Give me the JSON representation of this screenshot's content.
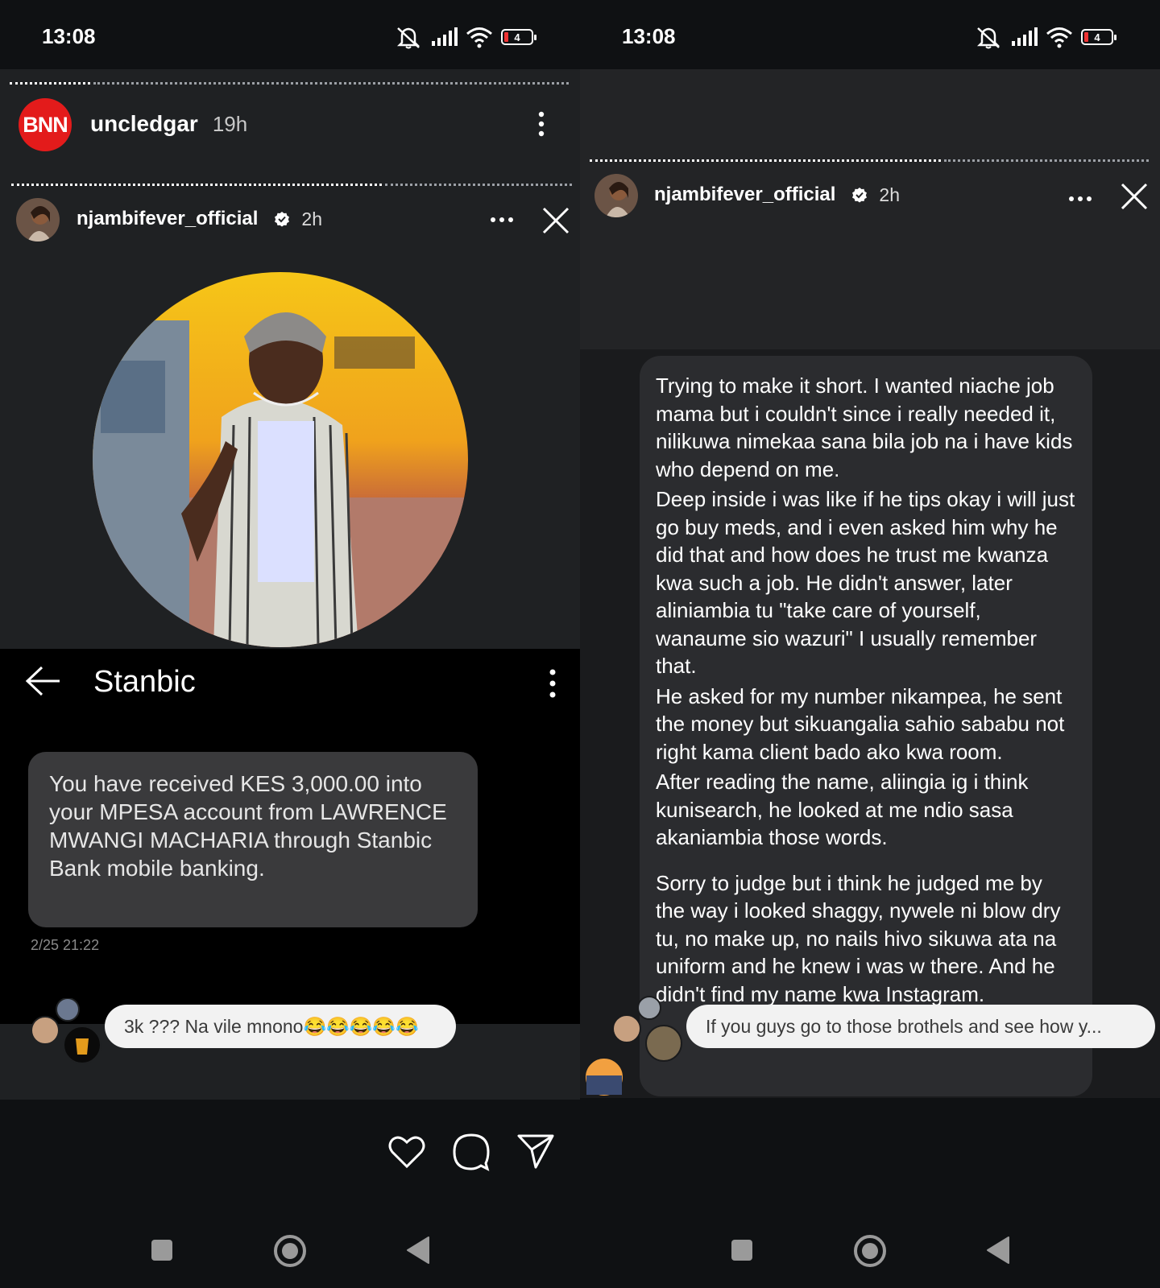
{
  "left": {
    "status": {
      "time": "13:08",
      "battery": "4"
    },
    "outer_story": {
      "username": "uncledgar",
      "age": "19h",
      "logo_text": "BNN"
    },
    "inner_story": {
      "username": "njambifever_official",
      "age": "2h"
    },
    "sms_app": {
      "title": "Stanbic",
      "message": "You have received KES 3,000.00 into your MPESA account from LAWRENCE MWANGI MACHARIA through Stanbic Bank mobile banking.",
      "timestamp": "2/25 21:22"
    },
    "reply": {
      "text": "3k ??? Na vile mnono😂😂😂😂😂"
    }
  },
  "right": {
    "status": {
      "time": "13:08",
      "battery": "4"
    },
    "story": {
      "username": "njambifever_official",
      "age": "2h"
    },
    "note_paragraphs": [
      "Trying to make it short. I wanted niache job mama but i couldn't since i really needed it, nilikuwa nimekaa sana bila job na i have kids who depend on me.",
      "Deep inside i was like if he tips okay i will just go buy meds, and i even asked him why he did that and how does he trust me kwanza kwa such a job. He didn't answer, later aliniambia tu \"take care of yourself, wanaume sio wazuri\" I usually remember that.",
      "He asked for my number nikampea, he sent the money but sikuangalia sahio sababu not right kama client bado ako kwa room.",
      "After reading the name, aliingia ig i think kunisearch, he looked at me ndio sasa akaniambia those words.",
      "Sorry to judge but i think he judged me by the way i looked shaggy, nywele ni blow dry tu, no make up, no nails hivo sikuwa ata na uniform and he knew i was w there. And he didn't find my name kwa Instagram."
    ],
    "reply": {
      "text": "If you guys go to those brothels and see how y..."
    }
  },
  "icons": {
    "status": [
      "mute-icon",
      "signal-icon",
      "wifi-icon",
      "battery-icon"
    ],
    "actions": [
      "heart-icon",
      "comment-icon",
      "share-icon"
    ],
    "nav": [
      "recents-icon",
      "home-icon",
      "back-icon"
    ]
  },
  "colors": {
    "background": "#0f1113",
    "panel": "#1f2123",
    "bnn_red": "#e31b1b",
    "sms_bubble": "#3a3a3c"
  }
}
